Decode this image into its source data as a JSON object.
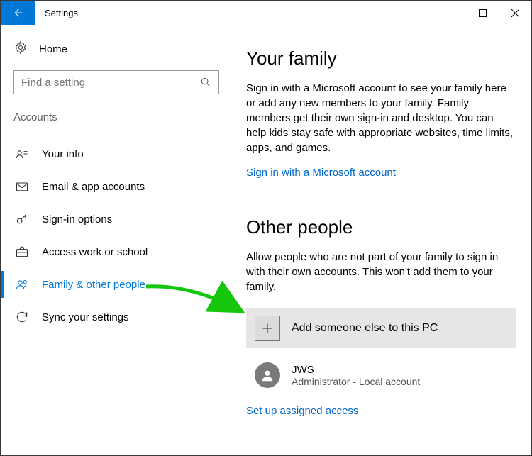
{
  "titlebar": {
    "title": "Settings"
  },
  "sidebar": {
    "home": "Home",
    "search_placeholder": "Find a setting",
    "category": "Accounts",
    "items": [
      {
        "label": "Your info"
      },
      {
        "label": "Email & app accounts"
      },
      {
        "label": "Sign-in options"
      },
      {
        "label": "Access work or school"
      },
      {
        "label": "Family & other people"
      },
      {
        "label": "Sync your settings"
      }
    ]
  },
  "main": {
    "family": {
      "heading": "Your family",
      "desc": "Sign in with a Microsoft account to see your family here or add any new members to your family. Family members get their own sign-in and desktop. You can help kids stay safe with appropriate websites, time limits, apps, and games.",
      "signin_link": "Sign in with a Microsoft account"
    },
    "other": {
      "heading": "Other people",
      "desc": "Allow people who are not part of your family to sign in with their own accounts. This won't add them to your family.",
      "add_label": "Add someone else to this PC",
      "user": {
        "name": "JWS",
        "sub": "Administrator - Local account"
      },
      "assigned_link": "Set up assigned access"
    }
  }
}
